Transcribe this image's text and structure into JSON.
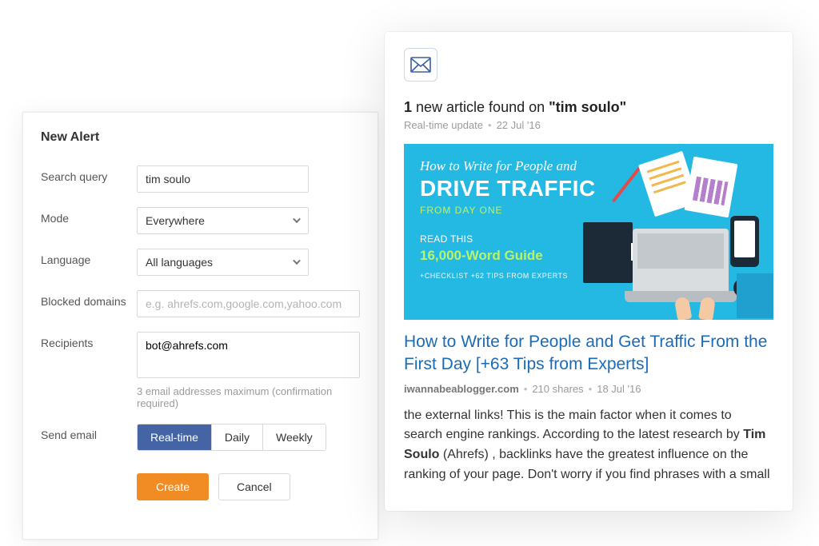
{
  "form": {
    "title": "New Alert",
    "labels": {
      "search_query": "Search query",
      "mode": "Mode",
      "language": "Language",
      "blocked_domains": "Blocked domains",
      "recipients": "Recipients",
      "send_email": "Send email"
    },
    "values": {
      "search_query": "tim soulo",
      "mode": "Everywhere",
      "language": "All languages",
      "blocked_domains_placeholder": "e.g. ahrefs.com,google.com,yahoo.com",
      "recipients": "bot@ahrefs.com"
    },
    "send_email_options": {
      "realtime": "Real-time",
      "daily": "Daily",
      "weekly": "Weekly"
    },
    "recipients_hint": "3 email addresses maximum (confirmation required)",
    "buttons": {
      "create": "Create",
      "cancel": "Cancel"
    }
  },
  "preview": {
    "headline_count": "1",
    "headline_mid": " new article found on ",
    "headline_query": "\"tim soulo\"",
    "sub_label": "Real-time update",
    "sub_date": "22 Jul '16",
    "thumb": {
      "script": "How to Write for People and",
      "big": "DRIVE TRAFFIC",
      "sub1": "FROM DAY ONE",
      "read": "READ THIS",
      "guide": "16,000-Word Guide",
      "foot": "+CHECKLIST +62 TIPS FROM EXPERTS"
    },
    "article_title": "How to Write for People and Get Traffic From the First Day [+63 Tips from Experts]",
    "meta_site": "iwannabeablogger.com",
    "meta_shares": "210 shares",
    "meta_date": "18 Jul '16",
    "excerpt_a": "the external links! This is the main factor when it comes to search engine rankings. According to the latest research by ",
    "excerpt_hl": "Tim Soulo",
    "excerpt_b": " (Ahrefs) , backlinks have the greatest influence on the ranking of your page. Don't worry if you find phrases with a small"
  }
}
